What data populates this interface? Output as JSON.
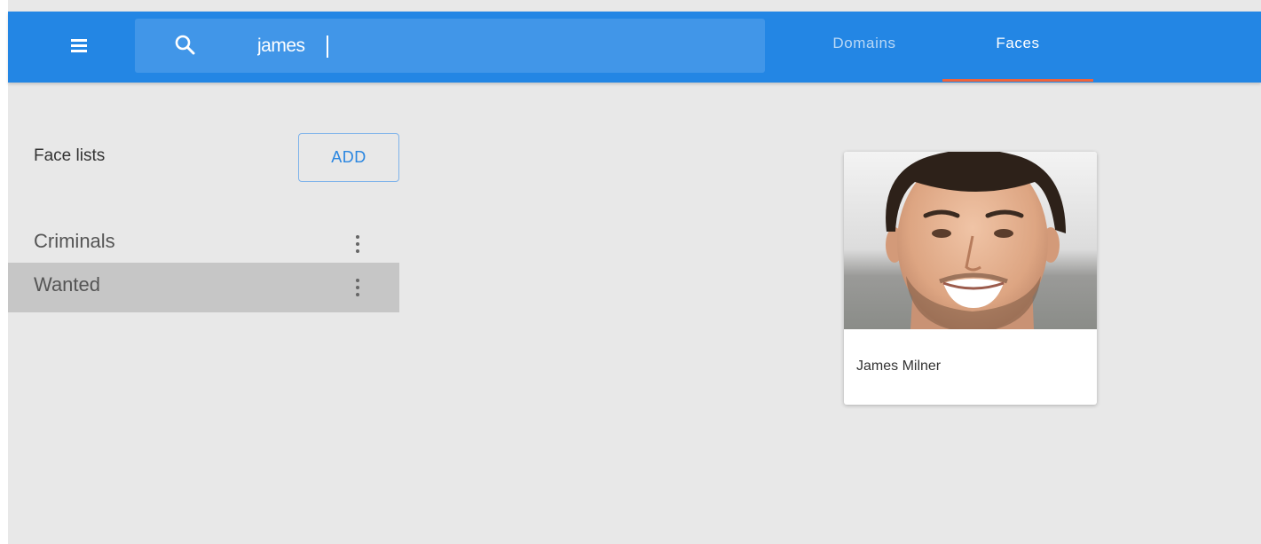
{
  "app": {
    "menu_icon": "menu-icon",
    "search": {
      "icon": "search-icon",
      "value": "james"
    },
    "tabs": [
      {
        "label": "Domains",
        "active": false
      },
      {
        "label": "Faces",
        "active": true
      }
    ],
    "colors": {
      "appbar": "#2386e4",
      "tab_indicator": "#f0633a",
      "accent": "#2a86e0"
    }
  },
  "sidebar": {
    "title": "Face lists",
    "add_label": "ADD",
    "lists": [
      {
        "label": "Criminals",
        "selected": false,
        "menu_icon": "more-vert-icon"
      },
      {
        "label": "Wanted",
        "selected": true,
        "menu_icon": "more-vert-icon"
      }
    ]
  },
  "faces": [
    {
      "name": "James Milner",
      "image": "face-photo"
    }
  ]
}
